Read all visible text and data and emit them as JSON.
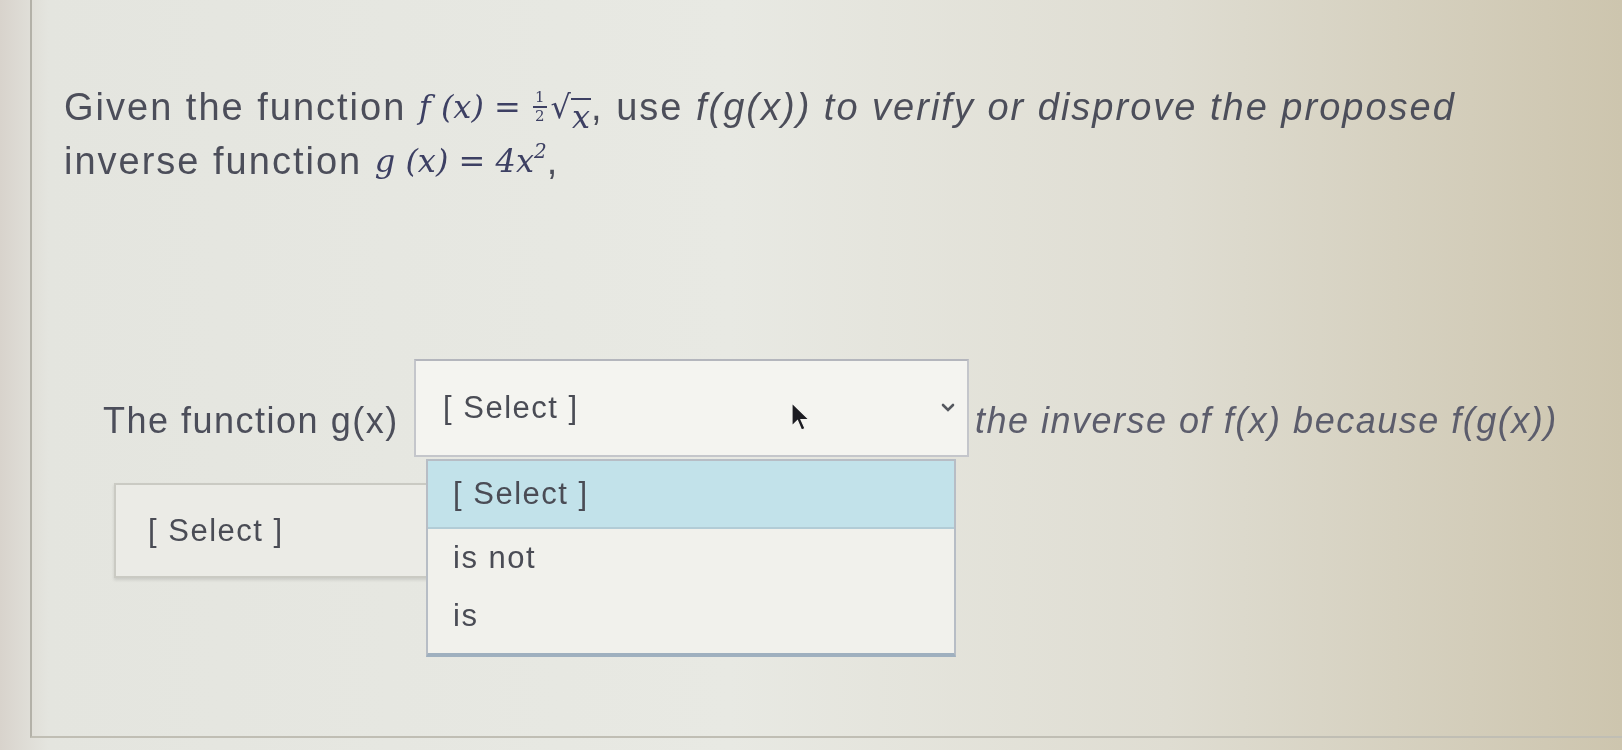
{
  "question": {
    "lines": [
      [
        {
          "kind": "text",
          "text": "Given the function "
        },
        {
          "kind": "math",
          "text": "f (x) = "
        },
        {
          "kind": "frac",
          "numerator": "1",
          "denominator": "2"
        },
        {
          "kind": "sqrt",
          "sign": "√",
          "radicand": "x"
        },
        {
          "kind": "text",
          "text": ", use *f(g(x)) to verify or disprove the proposed*"
        }
      ],
      [
        {
          "kind": "text",
          "text": "inverse function "
        },
        {
          "kind": "math",
          "text": "g (x) = 4x$^{2}$"
        },
        {
          "kind": "text",
          "text": ","
        }
      ]
    ]
  },
  "sentence": {
    "lead": "The function g(x)",
    "dropdown": {
      "value": "[ Select ]",
      "expanded": true,
      "options": [
        {
          "label": "[ Select ]",
          "selected": true
        },
        {
          "label": "is not",
          "selected": false
        },
        {
          "label": "is",
          "selected": false
        }
      ]
    },
    "tail": "the inverse of f(x) because f(g(x))"
  },
  "dropdown_2": {
    "value": "[ Select ]"
  }
}
